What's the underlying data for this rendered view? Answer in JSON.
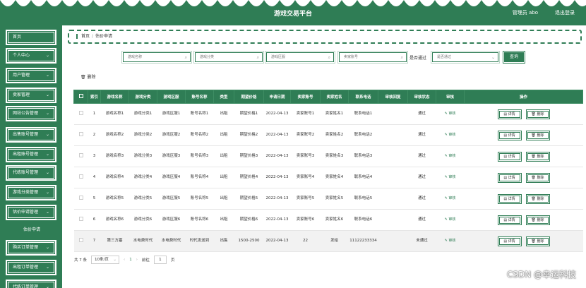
{
  "header": {
    "title": "游戏交易平台",
    "user": "管理员 abo",
    "logout": "退出登录"
  },
  "sidebar": {
    "items": [
      {
        "label": "首页",
        "chevron": false
      },
      {
        "label": "个人中心",
        "chevron": true
      },
      {
        "label": "用户管理",
        "chevron": true
      },
      {
        "label": "卖家管理",
        "chevron": true
      },
      {
        "label": "网站公告管理",
        "chevron": true
      },
      {
        "label": "出售账号管理",
        "chevron": true
      },
      {
        "label": "出租账号管理",
        "chevron": true
      },
      {
        "label": "代练账号管理",
        "chevron": true
      },
      {
        "label": "游戏分类管理",
        "chevron": true
      },
      {
        "label": "估价申请管理",
        "chevron": true
      },
      {
        "label": "购买订单管理",
        "chevron": true
      },
      {
        "label": "出租订单管理",
        "chevron": true
      },
      {
        "label": "代练订单管理",
        "chevron": true
      }
    ],
    "submenu": "估价申请"
  },
  "breadcrumb": {
    "home": "首页",
    "sep": "/",
    "current": "估价申请"
  },
  "filters": {
    "name_ph": "游戏名称",
    "category_ph": "游戏分类",
    "region_ph": "游戏区服",
    "seller_ph": "卖家账号",
    "pass_label": "是否通过",
    "pass_ph": "是否通过",
    "query": "查询"
  },
  "toolbar": {
    "delete": "删除"
  },
  "table": {
    "headers": [
      "索引",
      "游戏名称",
      "游戏分类",
      "游戏区服",
      "账号名称",
      "类型",
      "期望价格",
      "申请日期",
      "卖家账号",
      "卖家姓名",
      "联系电话",
      "审核回复",
      "审核状态",
      "审核",
      "操作"
    ],
    "rows": [
      [
        "1",
        "游戏名称1",
        "游戏分类1",
        "游戏区服1",
        "账号名称1",
        "出租",
        "期望价格1",
        "2022-04-13",
        "卖家账号1",
        "卖家姓名1",
        "联系电话1",
        "",
        "通过"
      ],
      [
        "2",
        "游戏名称2",
        "游戏分类2",
        "游戏区服2",
        "账号名称2",
        "出租",
        "期望价格2",
        "2022-04-13",
        "卖家账号2",
        "卖家姓名2",
        "联系电话2",
        "",
        "通过"
      ],
      [
        "3",
        "游戏名称3",
        "游戏分类3",
        "游戏区服3",
        "账号名称3",
        "出租",
        "期望价格3",
        "2022-04-13",
        "卖家账号3",
        "卖家姓名3",
        "联系电话3",
        "",
        "通过"
      ],
      [
        "4",
        "游戏名称4",
        "游戏分类4",
        "游戏区服4",
        "账号名称4",
        "出租",
        "期望价格4",
        "2022-04-13",
        "卖家账号4",
        "卖家姓名4",
        "联系电话4",
        "",
        "通过"
      ],
      [
        "5",
        "游戏名称5",
        "游戏分类5",
        "游戏区服5",
        "账号名称5",
        "出租",
        "期望价格5",
        "2022-04-13",
        "卖家账号5",
        "卖家姓名5",
        "联系电话5",
        "",
        "通过"
      ],
      [
        "6",
        "游戏名称6",
        "游戏分类6",
        "游戏区服6",
        "账号名称6",
        "出租",
        "期望价格6",
        "2022-04-13",
        "卖家账号6",
        "卖家姓名6",
        "联系电话6",
        "",
        "通过"
      ],
      [
        "7",
        "第三方塞",
        "水电费时代",
        "水电费时代",
        "时代发送到",
        "出售",
        "1500-2500",
        "2022-04-13",
        "22",
        "发给",
        "11122233334",
        "",
        "未通过"
      ]
    ],
    "audit_label": "审核",
    "detail_label": "详情",
    "delete_label": "删除"
  },
  "pager": {
    "total": "共 7 条",
    "page_size": "10条/页",
    "prev": "‹",
    "page": "1",
    "next": "›",
    "goto_label": "前往",
    "goto_value": "1",
    "page_unit": "页"
  },
  "watermark": "CSDN @幸运科技"
}
